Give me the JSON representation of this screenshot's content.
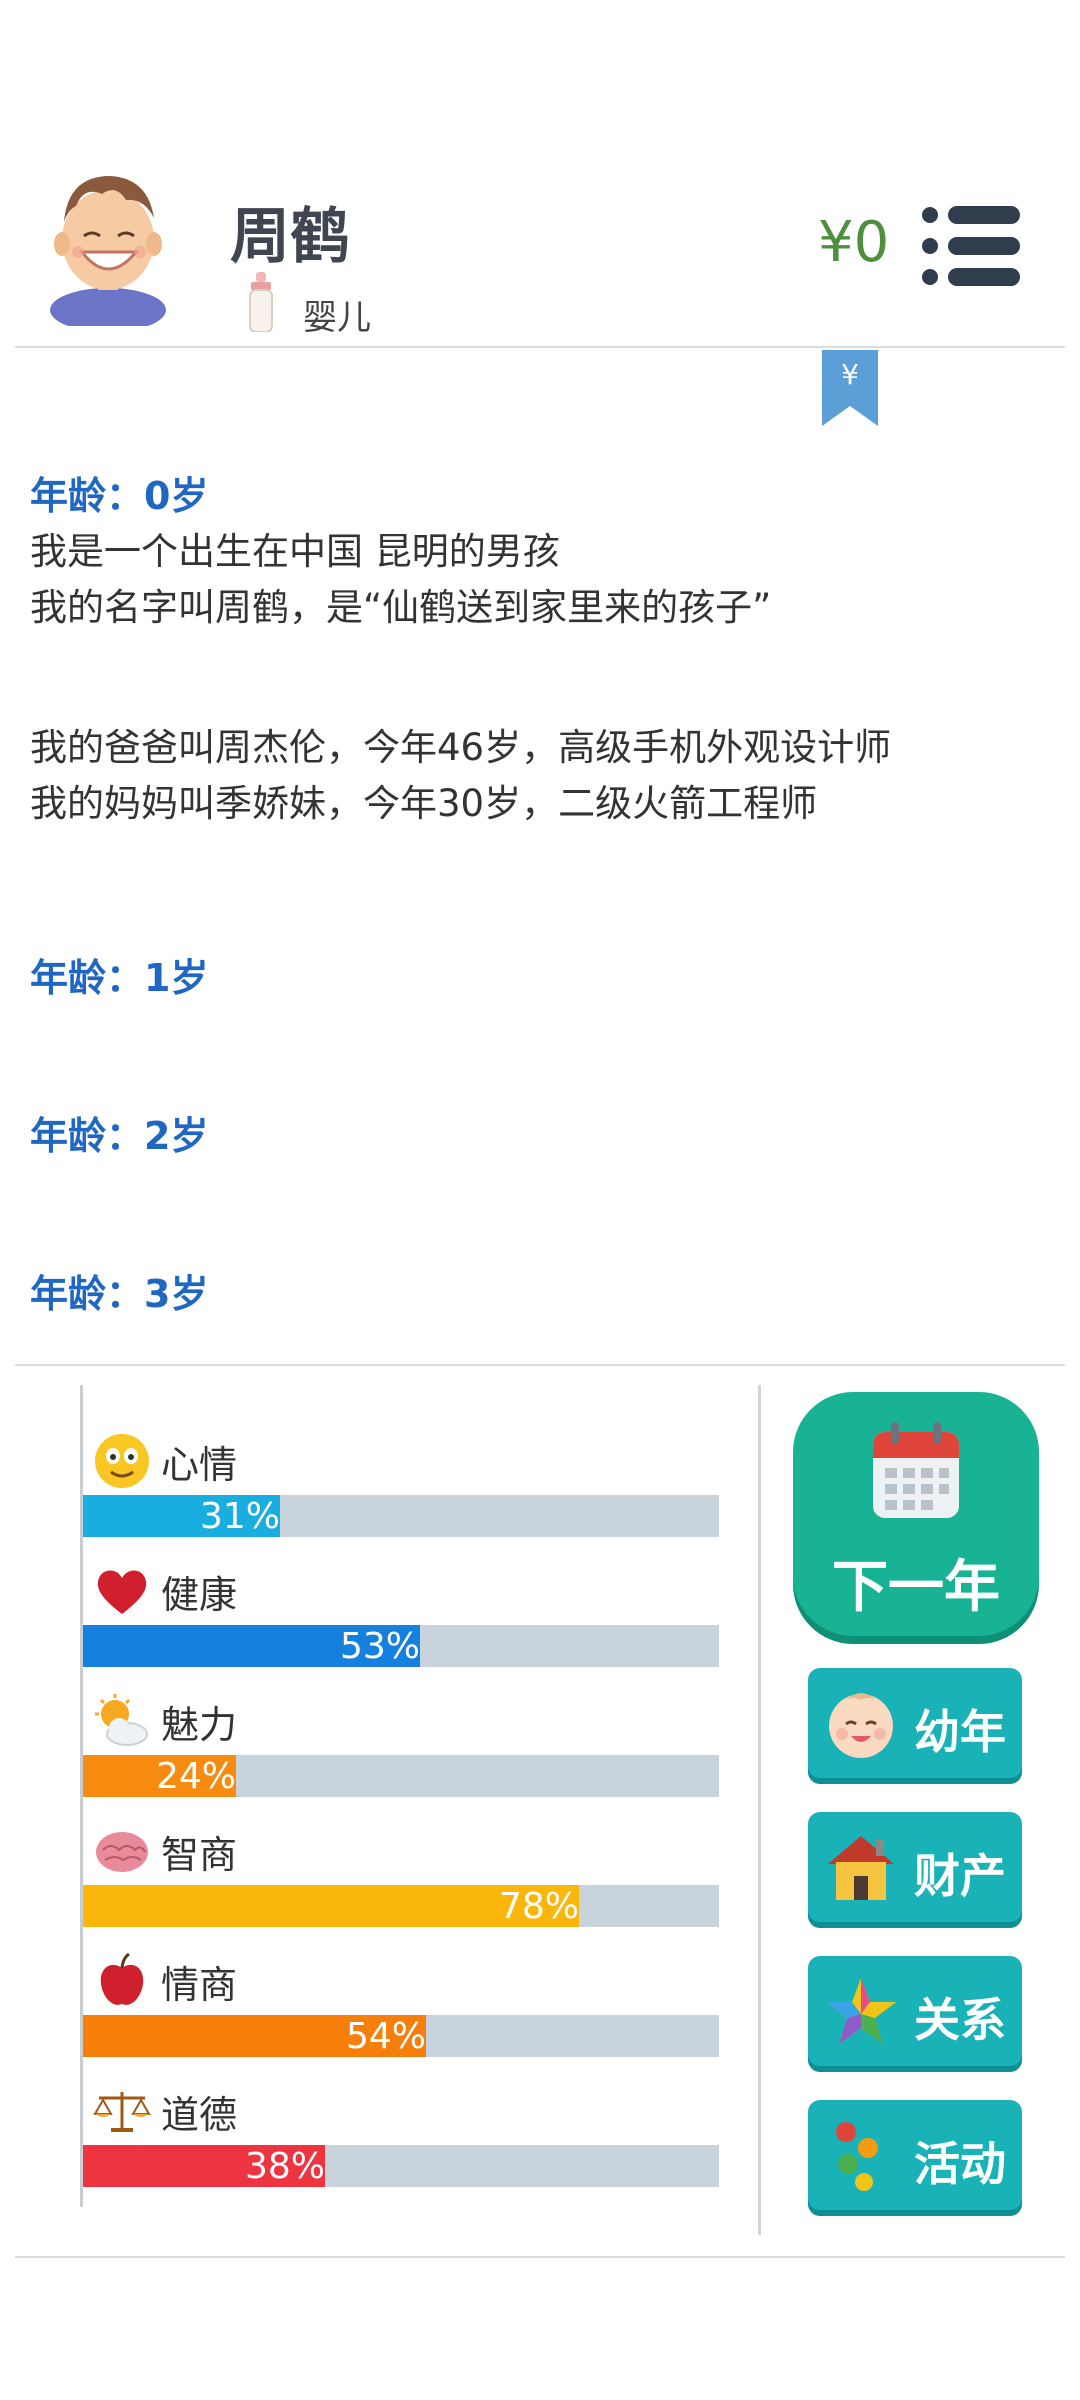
{
  "profile": {
    "name": "周鹤",
    "stage": "婴儿",
    "money": "¥0",
    "bookmark_symbol": "¥"
  },
  "log": {
    "entries": [
      {
        "age": "年龄：0岁",
        "lines": [
          "我是一个出生在中国 昆明的男孩",
          "我的名字叫周鹤，是“仙鹤送到家里来的孩子”",
          "",
          "我的爸爸叫周杰伦，今年46岁，高级手机外观设计师",
          "我的妈妈叫季娇妹，今年30岁，二级火箭工程师"
        ]
      },
      {
        "age": "年龄：1岁",
        "lines": []
      },
      {
        "age": "年龄：2岁",
        "lines": []
      },
      {
        "age": "年龄：3岁",
        "lines": []
      }
    ]
  },
  "stats": [
    {
      "name": "心情",
      "value": 31,
      "label": "31%",
      "color": "#1aaee0",
      "icon": "smiley-icon"
    },
    {
      "name": "健康",
      "value": 53,
      "label": "53%",
      "color": "#1680de",
      "icon": "heart-icon"
    },
    {
      "name": "魅力",
      "value": 24,
      "label": "24%",
      "color": "#f68b0f",
      "icon": "sun-cloud-icon"
    },
    {
      "name": "智商",
      "value": 78,
      "label": "78%",
      "color": "#fbb60b",
      "icon": "brain-icon"
    },
    {
      "name": "情商",
      "value": 54,
      "label": "54%",
      "color": "#f57f0a",
      "icon": "apple-icon"
    },
    {
      "name": "道德",
      "value": 38,
      "label": "38%",
      "color": "#ee3440",
      "icon": "scales-icon"
    }
  ],
  "buttons": {
    "next_year": "下一年",
    "childhood": "幼年",
    "assets": "财产",
    "relations": "关系",
    "activities": "活动"
  },
  "colors": {
    "accent_green": "#18b294",
    "side_button": "#19b2b7",
    "age_blue": "#1f67c2",
    "money_green": "#4e8f3e"
  }
}
